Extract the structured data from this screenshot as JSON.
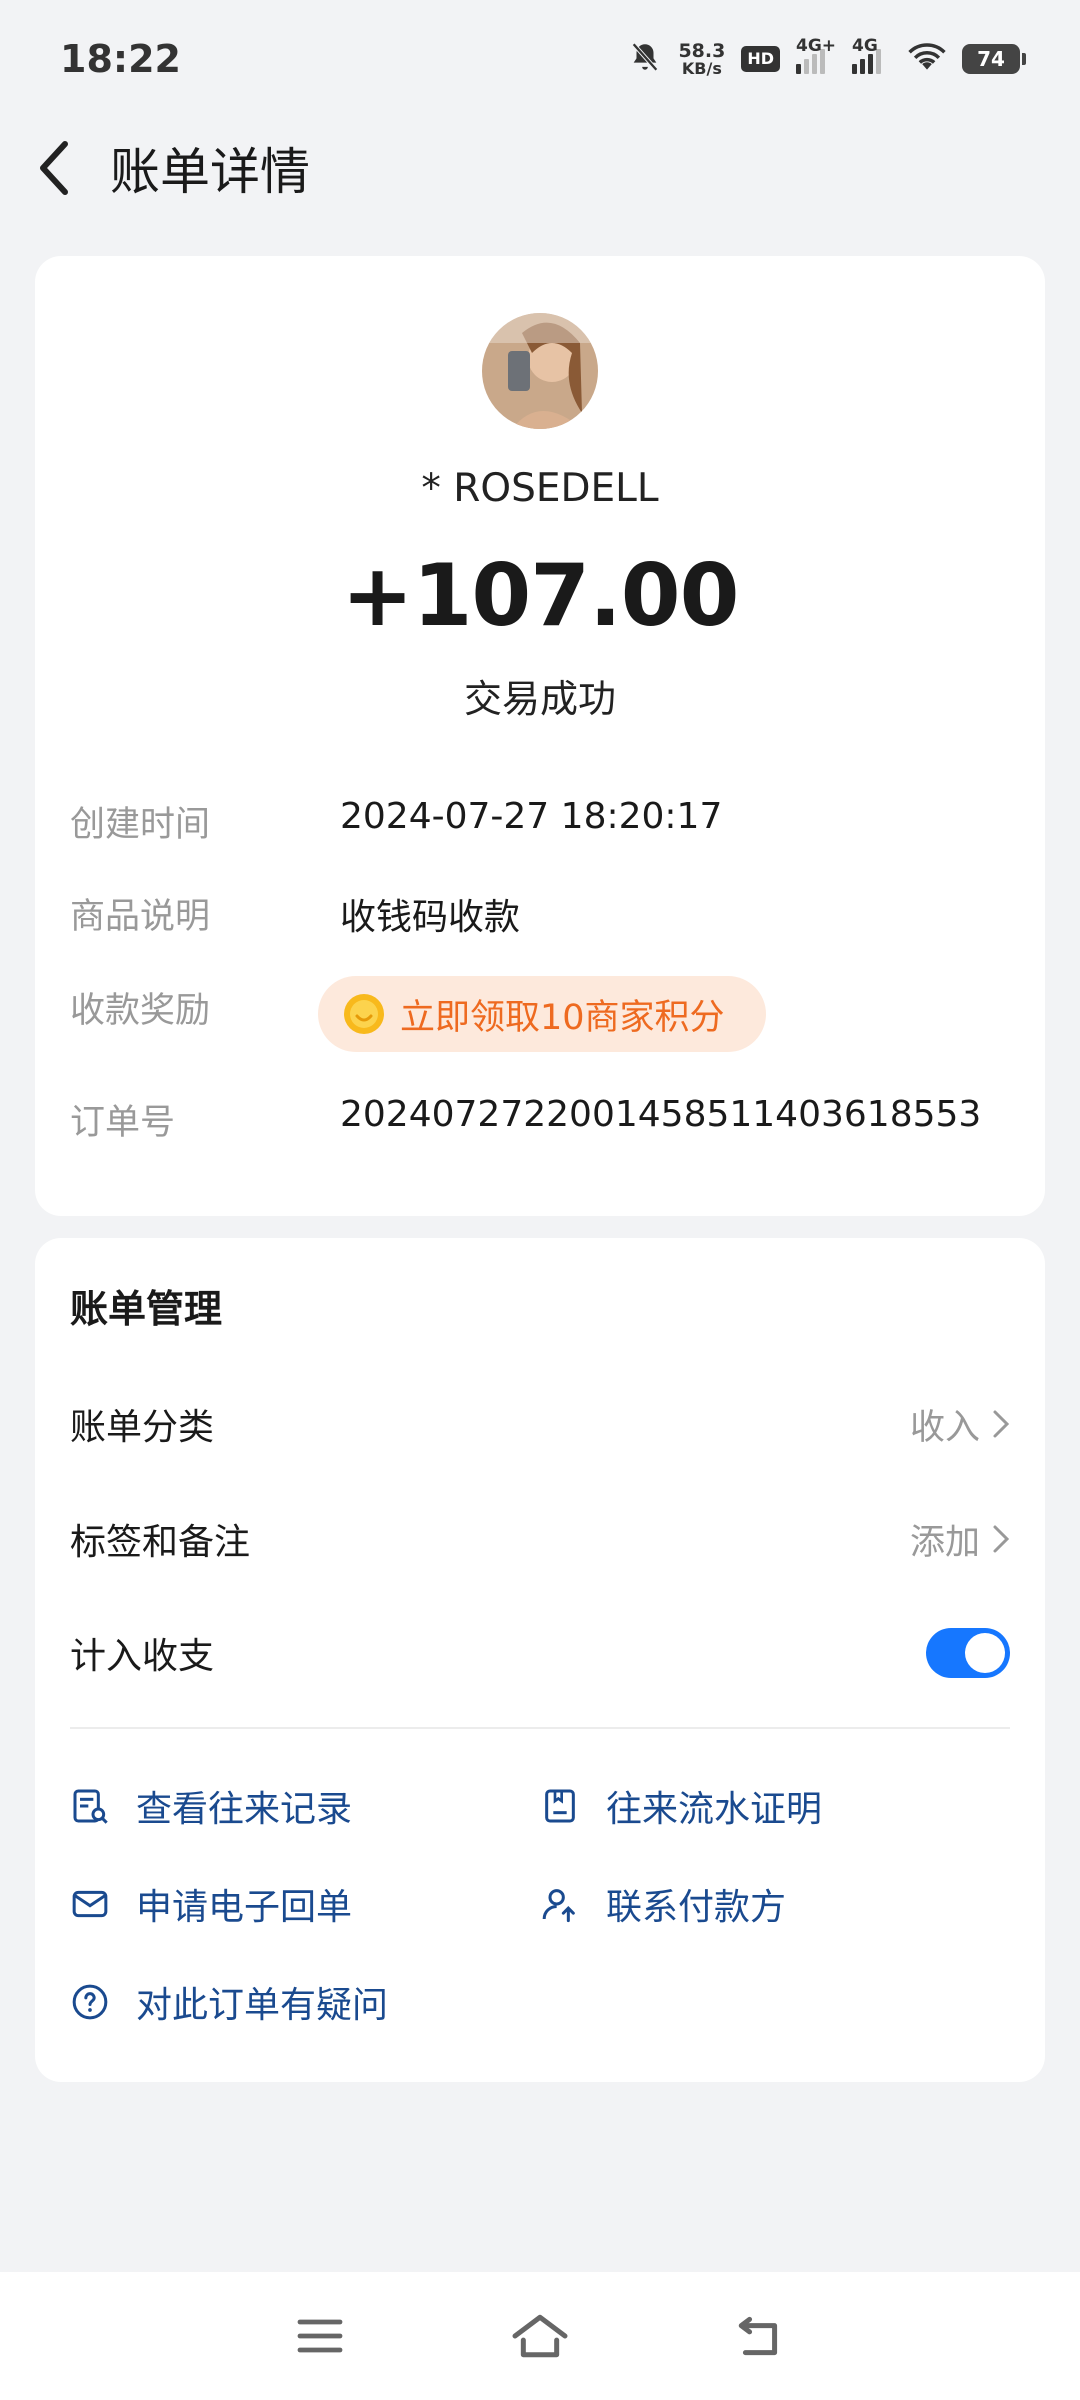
{
  "status_bar": {
    "time": "18:22",
    "speed_value": "58.3",
    "speed_unit": "KB/s",
    "hd_label": "HD",
    "sim1_label": "4G+",
    "sim2_label": "4G",
    "battery": "74"
  },
  "header": {
    "title": "账单详情",
    "back_icon": "chevron-left-icon"
  },
  "transaction": {
    "name": "* ROSEDELL",
    "amount": "+107.00",
    "status": "交易成功",
    "details": [
      {
        "label": "创建时间",
        "value": "2024-07-27 18:20:17"
      },
      {
        "label": "商品说明",
        "value": "收钱码收款"
      },
      {
        "label": "收款奖励",
        "value": "立即领取10商家积分"
      },
      {
        "label": "订单号",
        "value": "2024072722001458511403618553"
      }
    ]
  },
  "management": {
    "title": "账单管理",
    "rows": [
      {
        "label": "账单分类",
        "value": "收入"
      },
      {
        "label": "标签和备注",
        "value": "添加"
      },
      {
        "label": "计入收支",
        "toggle_on": true
      }
    ],
    "links": [
      {
        "label": "查看往来记录",
        "icon": "record-search-icon"
      },
      {
        "label": "往来流水证明",
        "icon": "document-icon"
      },
      {
        "label": "申请电子回单",
        "icon": "envelope-icon"
      },
      {
        "label": "联系付款方",
        "icon": "contact-person-icon"
      },
      {
        "label": "对此订单有疑问",
        "icon": "question-circle-icon"
      }
    ]
  },
  "colors": {
    "accent_blue": "#1677ff",
    "link_blue": "#1a4a8f",
    "reward_orange": "#ee6a20",
    "reward_bg": "#fde9dc"
  },
  "nav": {
    "menu_icon": "menu-icon",
    "home_icon": "home-icon",
    "back_icon": "back-icon"
  }
}
